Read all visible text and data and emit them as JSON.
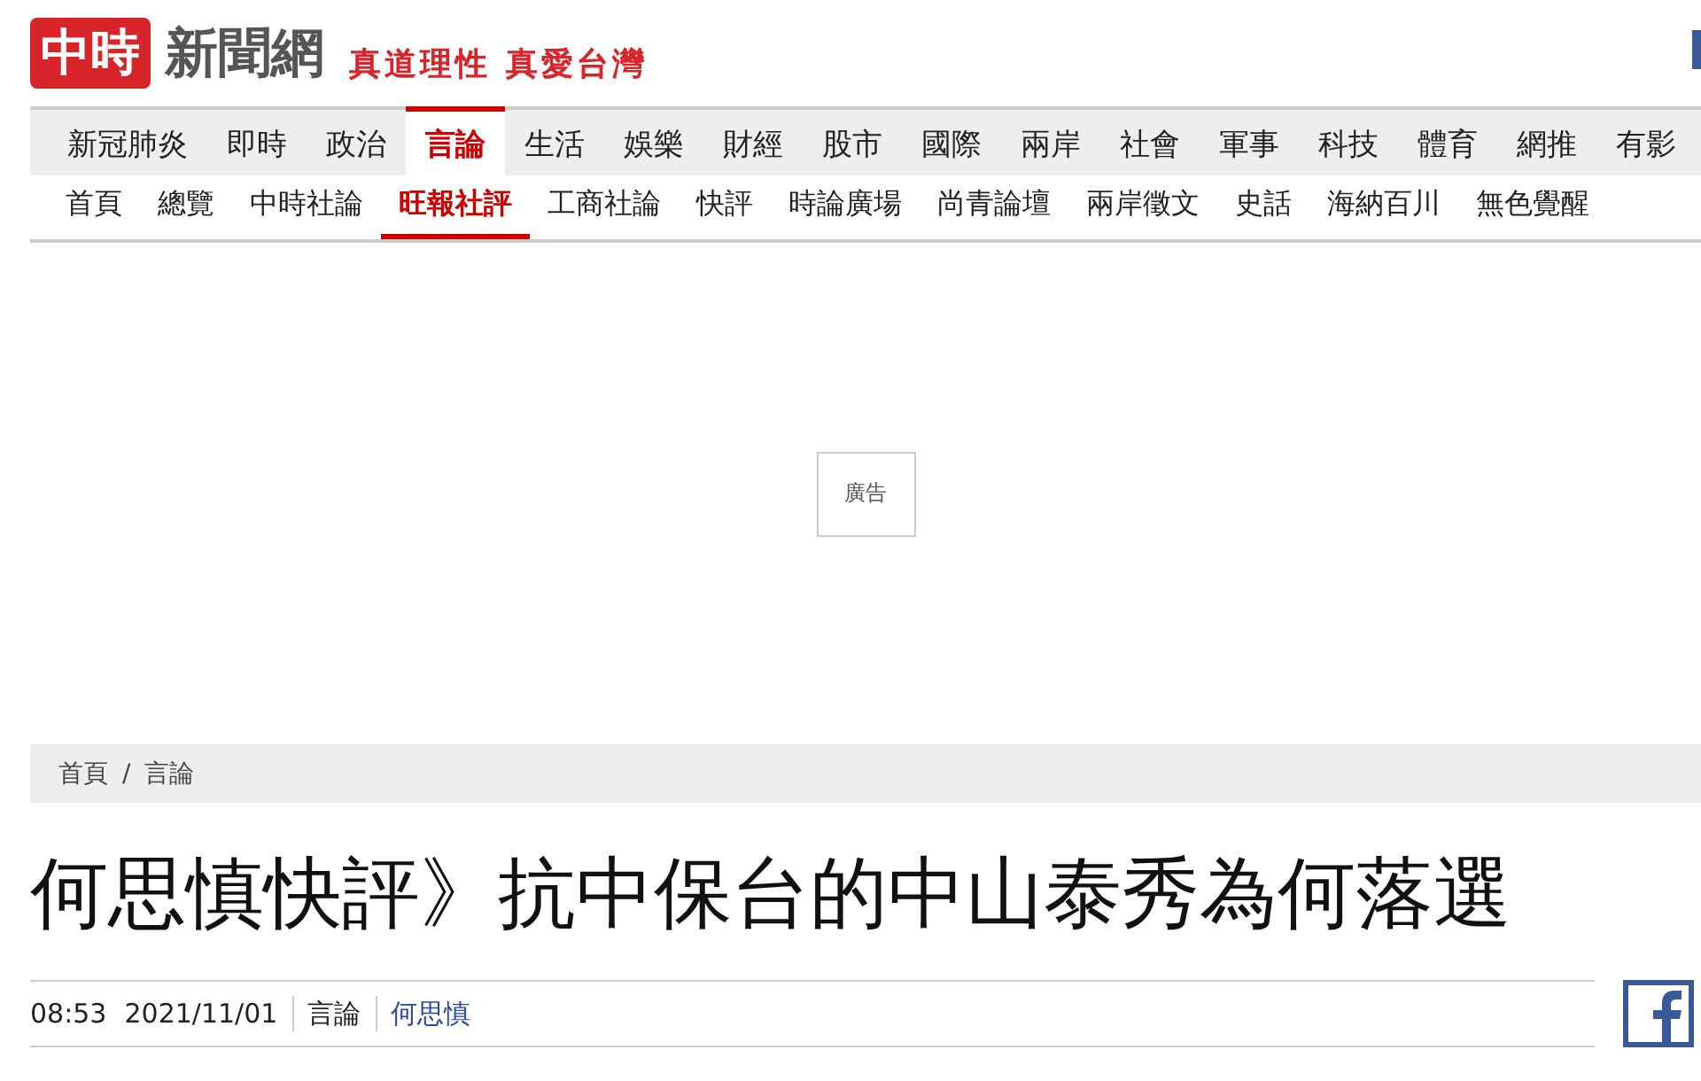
{
  "logo": {
    "mark": "中時",
    "name": "新聞網",
    "tagline": "真道理性 真愛台灣"
  },
  "main_nav": [
    {
      "label": "新冠肺炎",
      "selected": false
    },
    {
      "label": "即時",
      "selected": false
    },
    {
      "label": "政治",
      "selected": false
    },
    {
      "label": "言論",
      "selected": true
    },
    {
      "label": "生活",
      "selected": false
    },
    {
      "label": "娛樂",
      "selected": false
    },
    {
      "label": "財經",
      "selected": false
    },
    {
      "label": "股市",
      "selected": false
    },
    {
      "label": "國際",
      "selected": false
    },
    {
      "label": "兩岸",
      "selected": false
    },
    {
      "label": "社會",
      "selected": false
    },
    {
      "label": "軍事",
      "selected": false
    },
    {
      "label": "科技",
      "selected": false
    },
    {
      "label": "體育",
      "selected": false
    },
    {
      "label": "網推",
      "selected": false
    },
    {
      "label": "有影",
      "selected": false
    }
  ],
  "sub_nav": [
    {
      "label": "首頁",
      "selected": false
    },
    {
      "label": "總覽",
      "selected": false
    },
    {
      "label": "中時社論",
      "selected": false
    },
    {
      "label": "旺報社評",
      "selected": true
    },
    {
      "label": "工商社論",
      "selected": false
    },
    {
      "label": "快評",
      "selected": false
    },
    {
      "label": "時論廣場",
      "selected": false
    },
    {
      "label": "尚青論壇",
      "selected": false
    },
    {
      "label": "兩岸徵文",
      "selected": false
    },
    {
      "label": "史話",
      "selected": false
    },
    {
      "label": "海納百川",
      "selected": false
    },
    {
      "label": "無色覺醒",
      "selected": false
    }
  ],
  "ad": {
    "label": "廣告"
  },
  "breadcrumb": [
    "首頁",
    "言論"
  ],
  "breadcrumb_separator": "/",
  "article": {
    "title": "何思慎快評》抗中保台的中山泰秀為何落選",
    "time": "08:53",
    "date": "2021/11/01",
    "category": "言論",
    "author": "何思慎"
  }
}
